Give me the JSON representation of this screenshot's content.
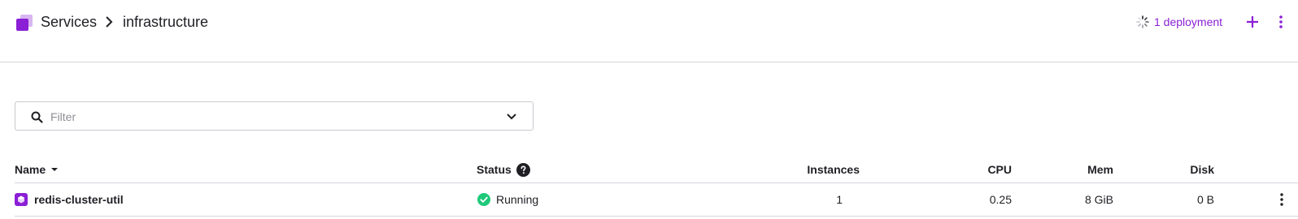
{
  "breadcrumb": {
    "root": "Services",
    "current": "infrastructure"
  },
  "header": {
    "deployments_label": "1 deployment",
    "add_icon": "plus-icon",
    "more_icon": "kebab-menu-icon"
  },
  "filter": {
    "placeholder": "Filter",
    "value": ""
  },
  "table": {
    "columns": {
      "name": "Name",
      "status": "Status",
      "instances": "Instances",
      "cpu": "CPU",
      "mem": "Mem",
      "disk": "Disk"
    },
    "sort": {
      "column": "Name",
      "direction": "descending"
    },
    "rows": [
      {
        "name": "redis-cluster-util",
        "status": "Running",
        "instances": "1",
        "cpu": "0.25",
        "mem": "8 GiB",
        "disk": "0 B"
      }
    ]
  },
  "colors": {
    "accent": "#8a1fd6",
    "status_running": "#1ec97a",
    "text": "#1f1f24",
    "border": "#d6d6dc"
  }
}
